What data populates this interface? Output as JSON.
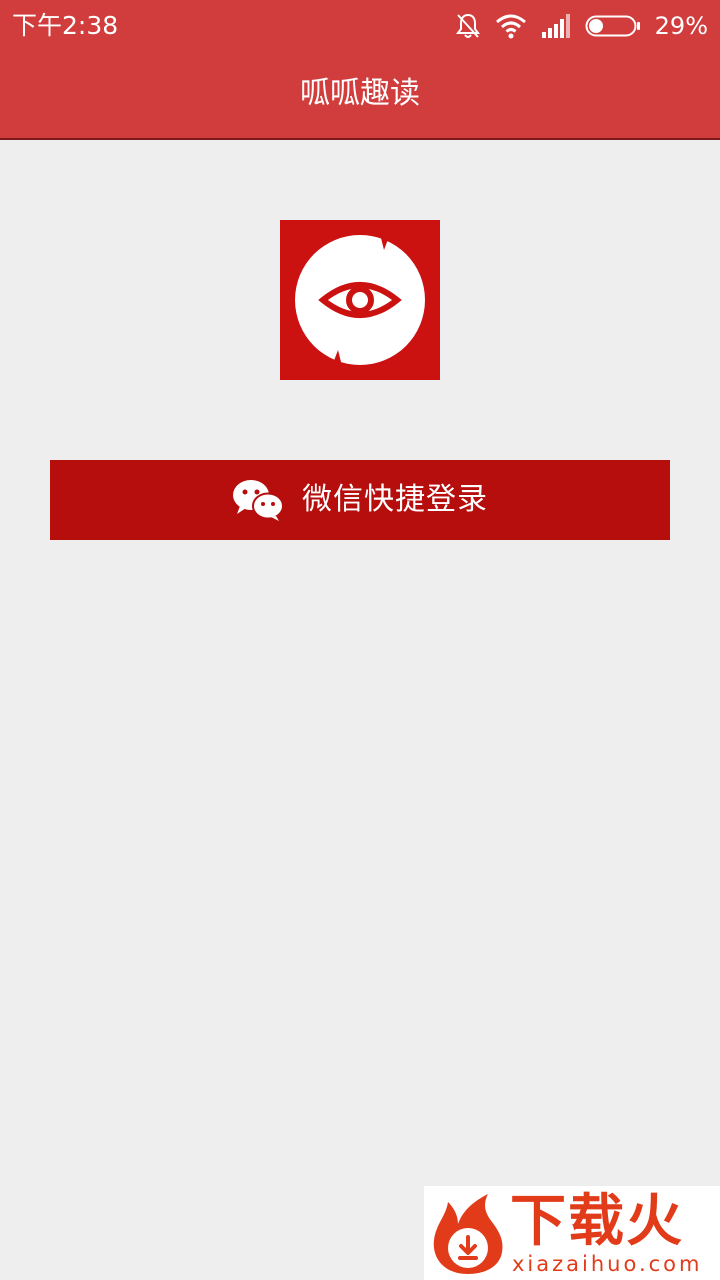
{
  "status_bar": {
    "time": "下午2:38",
    "battery_percent": "29%",
    "battery_level": 0.29,
    "icons": [
      "mute-bell-icon",
      "wifi-icon",
      "signal-icon",
      "battery-icon"
    ]
  },
  "app_bar": {
    "title": "呱呱趣读"
  },
  "logo": {
    "icon": "eye-logo-icon"
  },
  "login": {
    "label": "微信快捷登录",
    "icon": "wechat-icon"
  },
  "watermark": {
    "title": "下载火",
    "domain": "xiazaihuo.com",
    "icon": "flame-download-icon"
  },
  "colors": {
    "top_bar": "#d13c3c",
    "button": "#b60d0d",
    "background": "#eeeeee",
    "logo_red": "#cc1111",
    "watermark": "#e23b1a"
  }
}
